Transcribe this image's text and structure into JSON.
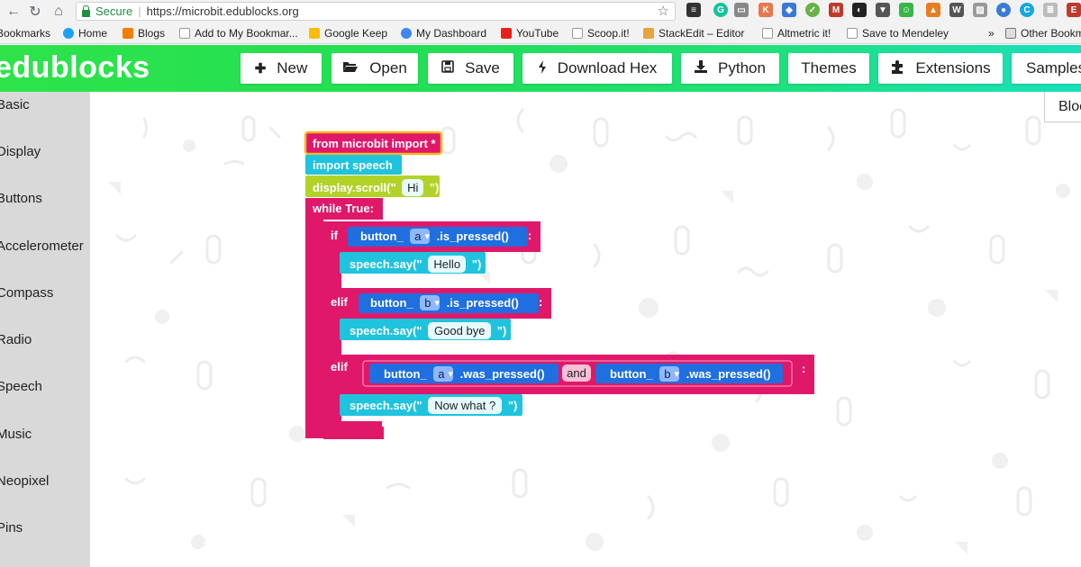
{
  "browser": {
    "secure_label": "Secure",
    "url": "https://microbit.edublocks.org"
  },
  "bookmarks": [
    "Bookmarks",
    "Home",
    "Blogs",
    "Add to My Bookmar...",
    "Google Keep",
    "My Dashboard",
    "YouTube",
    "Scoop.it!",
    "StackEdit – Editor",
    "Altmetric it!",
    "Save to Mendeley",
    "Other Bookmarks"
  ],
  "bookmarks_overflow": "»",
  "app": {
    "logo": "edublocks",
    "toolbar": [
      {
        "label": "New",
        "icon": "plus-icon"
      },
      {
        "label": "Open",
        "icon": "folder-open-icon"
      },
      {
        "label": "Save",
        "icon": "save-icon"
      },
      {
        "label": "Download Hex",
        "icon": "bolt-icon"
      },
      {
        "label": "Python",
        "icon": "download-icon"
      },
      {
        "label": "Themes",
        "icon": ""
      },
      {
        "label": "Extensions",
        "icon": "puzzle-icon"
      },
      {
        "label": "Samples",
        "icon": ""
      }
    ],
    "view_tab": "Blocks"
  },
  "categories": [
    "Basic",
    "Display",
    "Buttons",
    "Accelerometer",
    "Compass",
    "Radio",
    "Speech",
    "Music",
    "Neopixel",
    "Pins"
  ],
  "code": {
    "import_all": "from microbit import *",
    "import_speech": "import speech",
    "scroll_prefix": "display.scroll(\"",
    "scroll_text": "Hi",
    "string_close": "\")",
    "while_true": "while True:",
    "if_kw": "if",
    "elif_kw": "elif",
    "button_prefix": "button_",
    "btn_a": "a",
    "btn_b": "b",
    "is_pressed": ".is_pressed()",
    "was_pressed": ".was_pressed()",
    "and_kw": "and",
    "colon": ":",
    "say_prefix": "speech.say(\"",
    "say_hello": "Hello",
    "say_goodbye": "Good bye",
    "say_nowwhat": "Now what ?"
  },
  "colors": {
    "accent_green": "#22df55",
    "block_magenta": "#e0186a",
    "block_cyan": "#1fc3de",
    "block_blue": "#1f6fe0",
    "block_lime": "#b3d228",
    "block_yellow_border": "#f5b820"
  }
}
